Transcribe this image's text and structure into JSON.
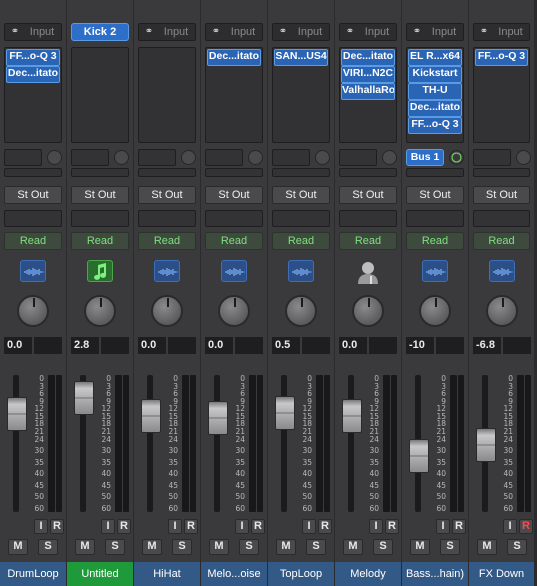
{
  "mixer": {
    "io_input_label": "Input",
    "output_label": "St Out",
    "automation_label": "Read",
    "mute_label": "M",
    "solo_label": "S",
    "input_monitor_label": "I",
    "record_label": "R",
    "fader_scale": [
      "0",
      "3",
      "6",
      "9",
      "12",
      "15",
      "18",
      "21",
      "24",
      "30",
      "35",
      "40",
      "45",
      "50",
      "60"
    ],
    "colors": {
      "plugin_blue": "#2a64b5",
      "automation_green": "#7ee07e",
      "name_selected": "#1f9a3a",
      "name_default": "#335a86",
      "record_red": "#ff4a4a"
    },
    "strips": [
      {
        "name": "DrumLoop",
        "instrument": null,
        "plugins": [
          "FF...o-Q 3",
          "Dec...itato"
        ],
        "send": null,
        "icon": "audio-wave-icon",
        "volume": "0.0",
        "fader_db": "-3",
        "selected": false,
        "record_armed": false
      },
      {
        "name": "Untitled",
        "instrument": "Kick 2",
        "plugins": [],
        "send": null,
        "icon": "music-note-icon",
        "volume": "2.8",
        "fader_db": "2.8",
        "selected": true,
        "record_armed": false
      },
      {
        "name": "HiHat",
        "instrument": null,
        "plugins": [],
        "send": null,
        "icon": "audio-wave-icon",
        "volume": "0.0",
        "fader_db": "0",
        "selected": false,
        "record_armed": false
      },
      {
        "name": "Melo...oise",
        "instrument": null,
        "plugins": [
          "Dec...itato"
        ],
        "send": null,
        "icon": "audio-wave-icon",
        "volume": "0.0",
        "fader_db": "0",
        "selected": false,
        "record_armed": false
      },
      {
        "name": "TopLoop",
        "instrument": null,
        "plugins": [
          "SAN...US4"
        ],
        "send": null,
        "icon": "audio-wave-icon",
        "volume": "0.5",
        "fader_db": "0.5",
        "selected": false,
        "record_armed": false
      },
      {
        "name": "Melody",
        "instrument": null,
        "plugins": [
          "Dec...itato",
          "VIRI...N2C",
          "ValhallaRo"
        ],
        "send": null,
        "icon": "person-icon",
        "volume": "0.0",
        "fader_db": "0",
        "selected": false,
        "record_armed": false
      },
      {
        "name": "Bass...hain)",
        "instrument": null,
        "plugins": [
          "EL R...x64",
          "Kickstart",
          "TH-U",
          "Dec...itato",
          "FF...o-Q 3"
        ],
        "send": "Bus 1",
        "icon": "audio-wave-icon",
        "volume": "-10",
        "fader_db": "-10",
        "selected": false,
        "record_armed": false
      },
      {
        "name": "FX Down",
        "instrument": null,
        "plugins": [
          "FF...o-Q 3"
        ],
        "send": null,
        "icon": "audio-wave-icon",
        "volume": "-6.8",
        "fader_db": "-6.8",
        "selected": false,
        "record_armed": true
      }
    ]
  }
}
